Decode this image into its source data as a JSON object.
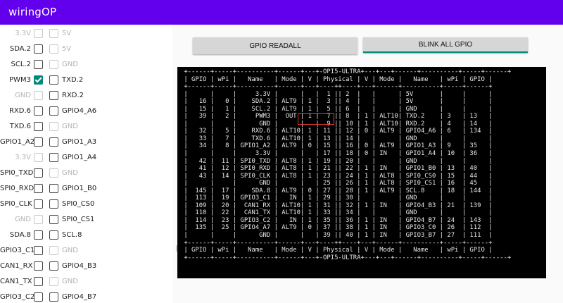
{
  "app": {
    "title": "wiringOP"
  },
  "pins": [
    {
      "left": "3.3V",
      "left_enabled": false,
      "left_checked": false,
      "right": "5V",
      "right_enabled": false
    },
    {
      "left": "SDA.2",
      "left_enabled": true,
      "left_checked": false,
      "right": "5V",
      "right_enabled": false
    },
    {
      "left": "SCL.2",
      "left_enabled": true,
      "left_checked": false,
      "right": "GND",
      "right_enabled": false
    },
    {
      "left": "PWM3",
      "left_enabled": true,
      "left_checked": true,
      "right": "TXD.2",
      "right_enabled": true
    },
    {
      "left": "GND",
      "left_enabled": false,
      "left_checked": false,
      "right": "RXD.2",
      "right_enabled": true
    },
    {
      "left": "RXD.6",
      "left_enabled": true,
      "left_checked": false,
      "right": "GPIO4_A6",
      "right_enabled": true
    },
    {
      "left": "TXD.6",
      "left_enabled": true,
      "left_checked": false,
      "right": "GND",
      "right_enabled": false
    },
    {
      "left": "GPIO1_A2",
      "left_enabled": true,
      "left_checked": false,
      "right": "GPIO1_A3",
      "right_enabled": true
    },
    {
      "left": "3.3V",
      "left_enabled": false,
      "left_checked": false,
      "right": "GPIO1_A4",
      "right_enabled": true
    },
    {
      "left": "SPI0_TXD",
      "left_enabled": true,
      "left_checked": false,
      "right": "GND",
      "right_enabled": false
    },
    {
      "left": "SPI0_RXD",
      "left_enabled": true,
      "left_checked": false,
      "right": "GPIO1_B0",
      "right_enabled": true
    },
    {
      "left": "SPI0_CLK",
      "left_enabled": true,
      "left_checked": false,
      "right": "SPI0_CS0",
      "right_enabled": true
    },
    {
      "left": "GND",
      "left_enabled": false,
      "left_checked": false,
      "right": "SPI0_CS1",
      "right_enabled": true
    },
    {
      "left": "SDA.8",
      "left_enabled": true,
      "left_checked": false,
      "right": "SCL.8",
      "right_enabled": true
    },
    {
      "left": "GPIO3_C1",
      "left_enabled": true,
      "left_checked": false,
      "right": "GND",
      "right_enabled": false
    },
    {
      "left": "CAN1_RX",
      "left_enabled": true,
      "left_checked": false,
      "right": "GPIO4_B3",
      "right_enabled": true
    },
    {
      "left": "CAN1_TX",
      "left_enabled": true,
      "left_checked": false,
      "right": "GND",
      "right_enabled": false
    },
    {
      "left": "GPIO3_C2",
      "left_enabled": true,
      "left_checked": false,
      "right": "GPIO4_B7",
      "right_enabled": true
    }
  ],
  "buttons": {
    "readall": "GPIO READALL",
    "blink": "BLINK ALL GPIO"
  },
  "terminal": {
    "lines": [
      " +------+-----+----------+------+---+-OPI5-ULTRA+---+---+------+----------+-----+------+",
      " | GPIO | wPi |   Name   | Mode | V | Physical | V | Mode |   Name   | wPi | GPIO |",
      " +------+-----+----------+------+---+----++----+---+------+----------+-----+------+",
      " |      |     |     3.3V |      |   |  1 || 2  |   |      | 5V       |     |      |",
      " |   16 |   0 |    SDA.2 | ALT9 | 1 |  3 || 4  |   |      | 5V       |     |      |",
      " |   15 |   1 |    SCL.2 | ALT9 | 1 |  5 || 6  |   |      | GND      |     |      |",
      " |   39 |   2 |     PWM3 |  OUT | 1 |  7 || 8  | 1 | ALT10| TXD.2    | 3   | 13   |",
      " |      |     |      GND |      |   |  9 || 10 | 1 | ALT10| RXD.2    | 4   | 14   |",
      " |   32 |   5 |    RXD.6 | ALT10| 1 | 11 || 12 | 0 | ALT9 | GPIO4_A6 | 6   | 134  |",
      " |   33 |   7 |    TXD.6 | ALT10| 1 | 13 || 14 |   |      | GND      |     |      |",
      " |   34 |   8 | GPIO1_A2 | ALT9 | 0 | 15 || 16 | 0 | ALT9 | GPIO1_A3 | 9   | 35   |",
      " |      |     |     3.3V |      |   | 17 || 18 | 0 | IN   | GPIO1_A4 | 10  | 36   |",
      " |   42 |  11 | SPI0_TXD | ALT8 | 1 | 19 || 20 |   |      | GND      |     |      |",
      " |   41 |  12 | SPI0_RXD | ALT8 | 1 | 21 || 22 | 1 | IN   | GPIO1_B0 | 13  | 40   |",
      " |   43 |  14 | SPI0_CLK | ALT8 | 1 | 23 || 24 | 1 | ALT8 | SPI0_CS0 | 15  | 44   |",
      " |      |     |      GND |      |   | 25 || 26 | 1 | ALT8 | SPI0_CS1 | 16  | 45   |",
      " |  145 |  17 |    SDA.8 | ALT9 | 0 | 27 || 28 | 1 | ALT9 | SCL.8    | 18  | 144  |",
      " |  113 |  19 | GPIO3_C1 |   IN | 1 | 29 || 30 |   |      | GND      |     |      |",
      " |  109 |  20 |  CAN1_RX | ALT10| 1 | 31 || 32 | 1 | IN   | GPIO4_B3 | 21  | 139  |",
      " |  110 |  22 |  CAN1_TX | ALT10| 1 | 33 || 34 |   |      | GND      |     |      |",
      " |  114 |  23 | GPIO3_C2 |   IN | 1 | 35 || 36 | 1 | IN   | GPIO4_B7 | 24  | 143  |",
      " |  135 |  25 | GPIO4_A7 | ALT9 | 0 | 37 || 38 | 1 | IN   | GPIO3_C0 | 26  | 112  |",
      " |      |     |      GND |      |   | 39 || 40 | 1 | IN   | GPIO3_B7 | 27  | 111  |",
      " +------+-----+----------+------+---+----++----+---+------+----------+-----+------+",
      " | GPIO | wPi |   Name   | Mode | V | Physical | V | Mode |   Name   | wPi | GPIO |",
      " +------+-----+----------+------+---+-OPI5-ULTRA+---+---+------+----------+-----+------+"
    ]
  },
  "colors": {
    "appbar": "#6200ee",
    "accent": "#00897b",
    "highlight": "#e53935"
  }
}
